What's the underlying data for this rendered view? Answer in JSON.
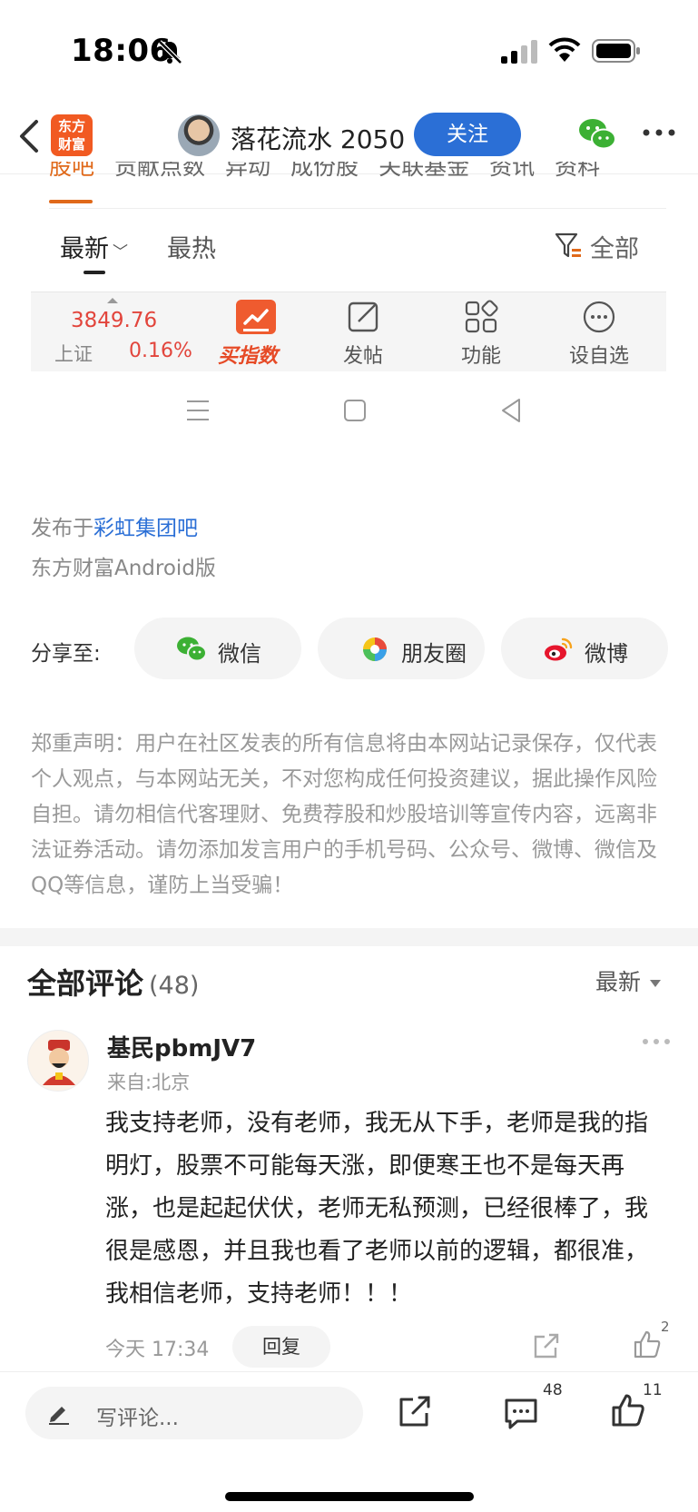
{
  "status_bar": {
    "time": "18:06"
  },
  "header": {
    "app_logo": "东方\n财富",
    "user_name": "落花流水 2050",
    "follow_label": "关注"
  },
  "tabs": [
    "股吧",
    "贡献点数",
    "异动",
    "成份股",
    "关联基金",
    "资讯",
    "资料"
  ],
  "sort": {
    "latest": "最新",
    "hot": "最热",
    "filter": "全部"
  },
  "index": {
    "value": "3849.76",
    "name": "上证",
    "change": "0.16%"
  },
  "actions": {
    "buy_label": "买指数",
    "post_label": "发帖",
    "func_label": "功能",
    "watch_label": "设自选"
  },
  "post": {
    "from_prefix": "发布于",
    "bar_name": "彩虹集团吧",
    "client": "东方财富Android版"
  },
  "share": {
    "label": "分享至:",
    "wechat": "微信",
    "moments": "朋友圈",
    "weibo": "微博"
  },
  "disclaimer": "郑重声明：用户在社区发表的所有信息将由本网站记录保存，仅代表个人观点，与本网站无关，不对您构成任何投资建议，据此操作风险自担。请勿相信代客理财、免费荐股和炒股培训等宣传内容，远离非法证券活动。请勿添加发言用户的手机号码、公众号、微博、微信及QQ等信息，谨防上当受骗！",
  "comments": {
    "title": "全部评论",
    "count": "(48)",
    "sort": "最新",
    "items": [
      {
        "author": "基民pbmJV7",
        "location": "来自:北京",
        "body": "我支持老师，没有老师，我无从下手，老师是我的指明灯，股票不可能每天涨，即便寒王也不是每天再涨，也是起起伏伏，老师无私预测，已经很棒了，我很是感恩，并且我也看了老师以前的逻辑，都很准，我相信老师，支持老师！！！",
        "time": "今天 17:34",
        "reply": "回复",
        "likes": "2"
      }
    ]
  },
  "bottom": {
    "comment_placeholder": "写评论...",
    "comment_count": "48",
    "like_count": "11"
  },
  "colors": {
    "accent": "#2b6fd6",
    "brand": "#f15a22",
    "up": "#e2453c"
  }
}
